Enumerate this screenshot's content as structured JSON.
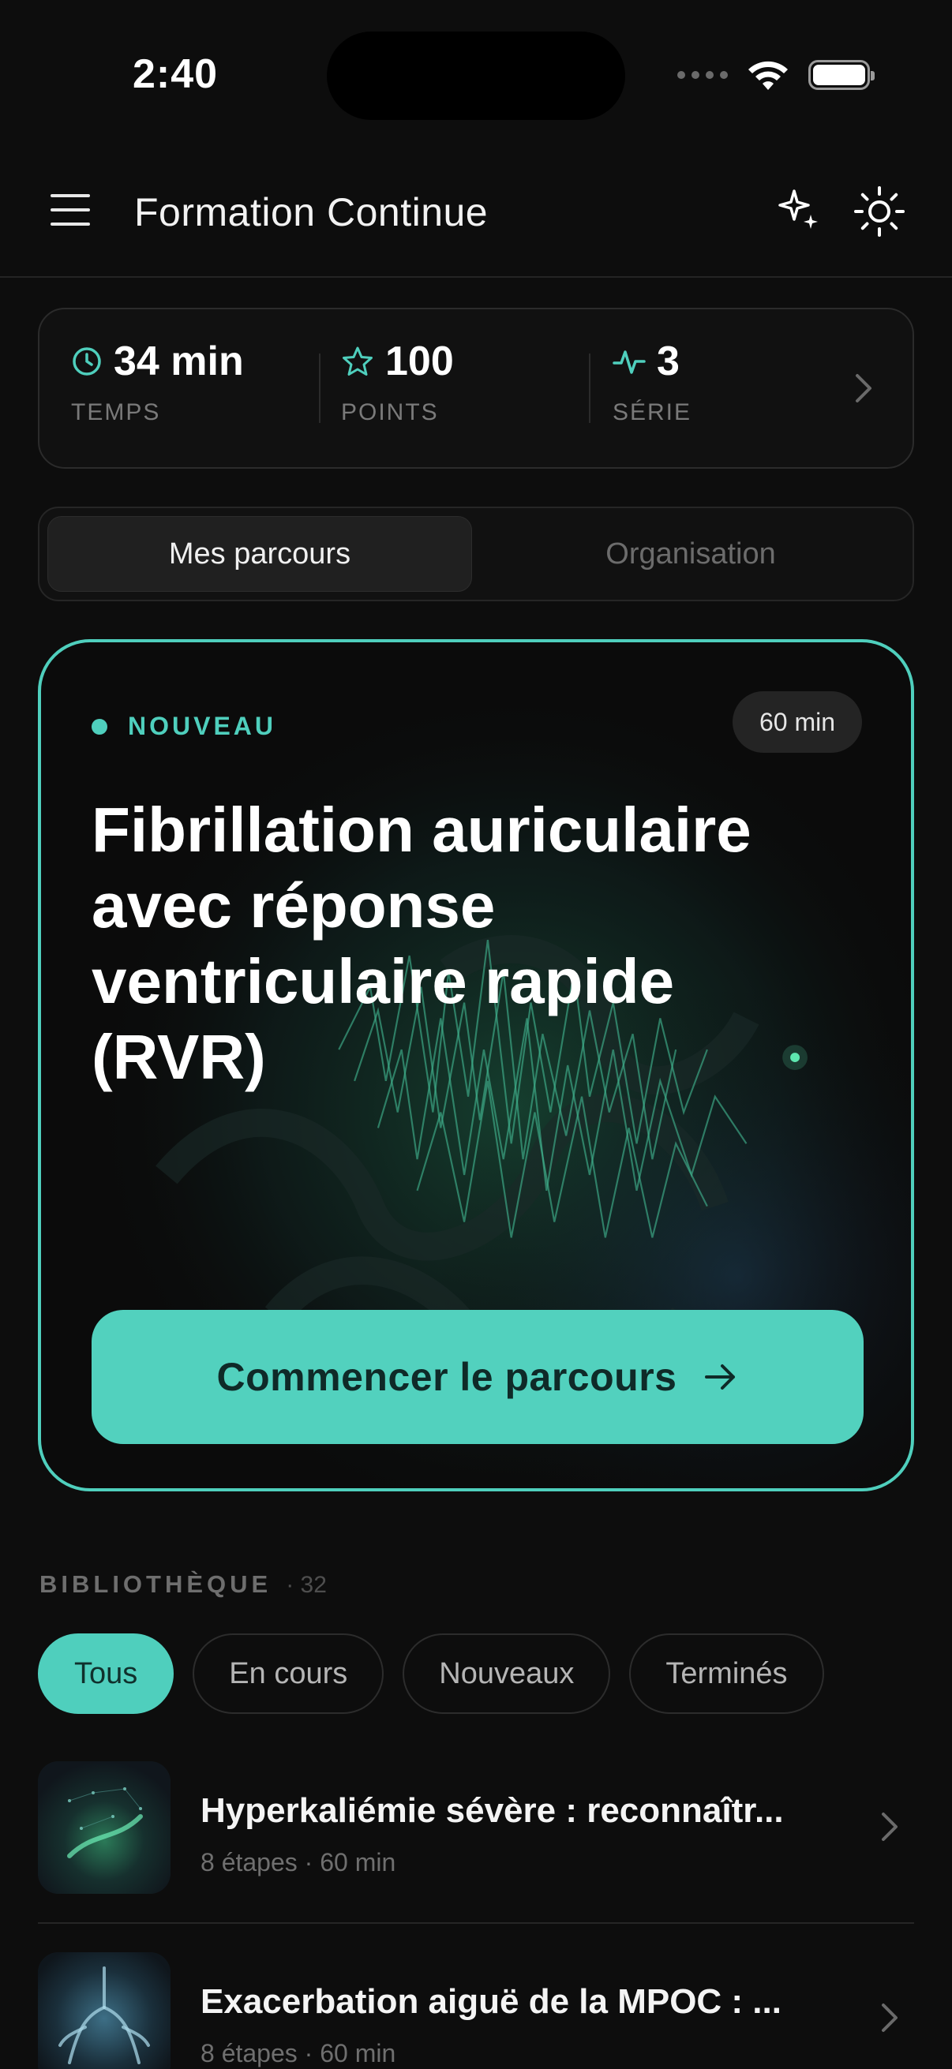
{
  "status_bar": {
    "time": "2:40"
  },
  "header": {
    "title": "Formation Continue"
  },
  "stats": [
    {
      "value": "34 min",
      "label": "TEMPS",
      "icon": "clock-icon"
    },
    {
      "value": "100",
      "label": "POINTS",
      "icon": "star-icon"
    },
    {
      "value": "3",
      "label": "SÉRIE",
      "icon": "activity-icon"
    }
  ],
  "tabs": [
    {
      "label": "Mes parcours",
      "active": true
    },
    {
      "label": "Organisation",
      "active": false
    }
  ],
  "featured": {
    "badge": "NOUVEAU",
    "duration": "60 min",
    "title": "Fibrillation auriculaire avec réponse ventriculaire rapide (RVR)",
    "cta": "Commencer le parcours"
  },
  "library": {
    "title": "BIBLIOTHÈQUE",
    "count": "· 32",
    "filters": [
      {
        "label": "Tous",
        "active": true
      },
      {
        "label": "En cours",
        "active": false
      },
      {
        "label": "Nouveaux",
        "active": false
      },
      {
        "label": "Terminés",
        "active": false
      }
    ],
    "items": [
      {
        "title": "Hyperkaliémie sévère : reconnaîtr...",
        "meta": "8 étapes · 60 min"
      },
      {
        "title": "Exacerbation aiguë de la MPOC : ...",
        "meta": "8 étapes · 60 min"
      }
    ]
  },
  "colors": {
    "accent": "#4fcfbd",
    "background": "#0d0d0d",
    "card": "#111111"
  }
}
